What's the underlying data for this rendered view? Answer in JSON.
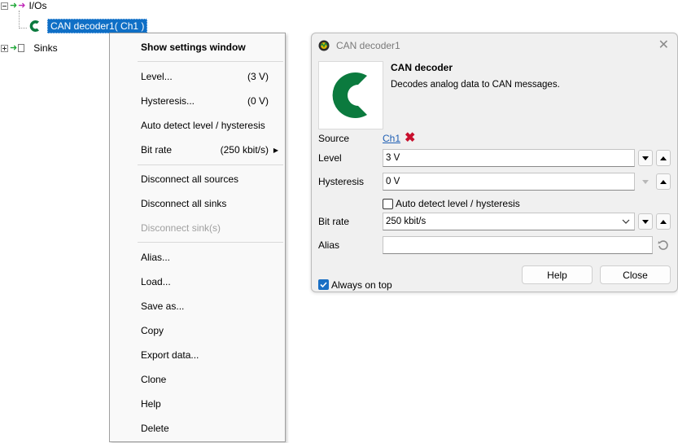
{
  "tree": {
    "ios_label": "I/Os",
    "decoder_label": "CAN decoder1( Ch1 )",
    "sinks_label": "Sinks"
  },
  "menu": {
    "items": [
      {
        "label": "Show settings window",
        "value": ""
      },
      {
        "label": "Level...",
        "value": "(3 V)"
      },
      {
        "label": "Hysteresis...",
        "value": "(0 V)"
      },
      {
        "label": "Auto detect level / hysteresis",
        "value": ""
      },
      {
        "label": "Bit rate",
        "value": "(250 kbit/s)"
      },
      {
        "label": "Disconnect all sources",
        "value": ""
      },
      {
        "label": "Disconnect all sinks",
        "value": ""
      },
      {
        "label": "Disconnect sink(s)",
        "value": ""
      },
      {
        "label": "Alias...",
        "value": ""
      },
      {
        "label": "Load...",
        "value": ""
      },
      {
        "label": "Save as...",
        "value": ""
      },
      {
        "label": "Copy",
        "value": ""
      },
      {
        "label": "Export data...",
        "value": ""
      },
      {
        "label": "Clone",
        "value": ""
      },
      {
        "label": "Help",
        "value": ""
      },
      {
        "label": "Delete",
        "value": ""
      }
    ]
  },
  "dialog": {
    "title": "CAN decoder1",
    "heading": "CAN decoder",
    "description": "Decodes analog data to CAN messages.",
    "source_label": "Source",
    "source_value": "Ch1",
    "level_label": "Level",
    "level_value": "3 V",
    "hysteresis_label": "Hysteresis",
    "hysteresis_value": "0 V",
    "auto_detect_label": "Auto detect level / hysteresis",
    "auto_detect_checked": false,
    "bitrate_label": "Bit rate",
    "bitrate_value": "250 kbit/s",
    "alias_label": "Alias",
    "alias_value": "",
    "always_on_top_label": "Always on top",
    "always_on_top_checked": true,
    "help_button": "Help",
    "close_button": "Close"
  },
  "colors": {
    "brand_green": "#0b7a3e",
    "selection_blue": "#0f6fc6",
    "remove_red": "#c8102e"
  }
}
